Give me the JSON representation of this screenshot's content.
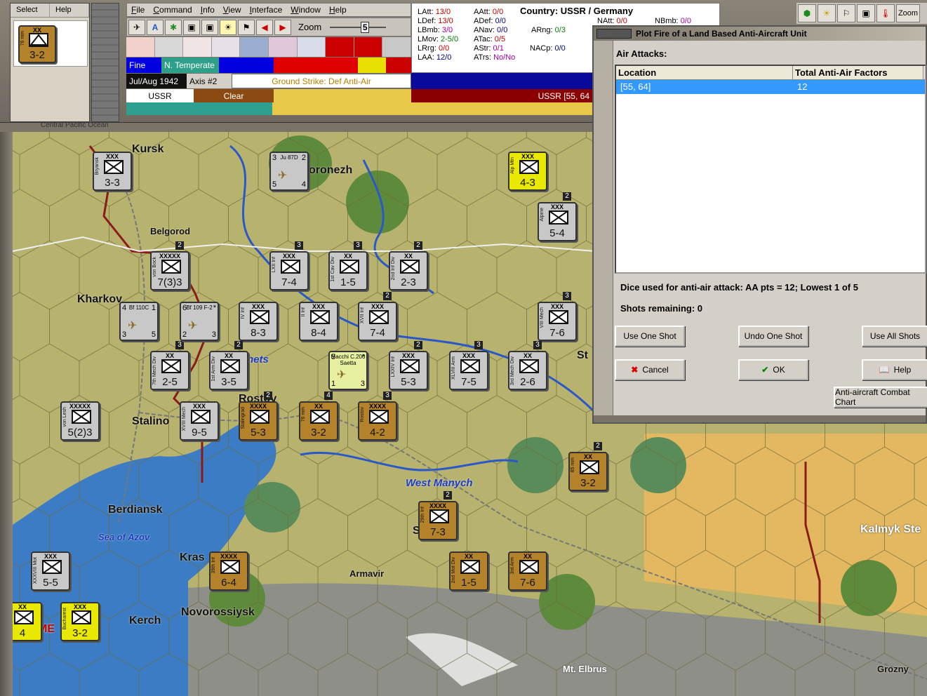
{
  "mini_panel": {
    "menu": [
      "Select",
      "Help"
    ],
    "unit_size": "XX",
    "unit_label": "76 mm",
    "unit_value": "3-2"
  },
  "menu": [
    "File",
    "Command",
    "Info",
    "View",
    "Interface",
    "Window",
    "Help"
  ],
  "toolbar": {
    "zoom_label": "Zoom",
    "zoom_value": "5"
  },
  "weather": {
    "ground": "Fine",
    "climate": "N. Temperate"
  },
  "turn": {
    "date": "Jul/Aug 1942",
    "phase": "Axis #2",
    "mission": "Ground Strike: Def Anti-Air"
  },
  "nation_row": {
    "nation": "USSR",
    "terrain": "Clear",
    "hex": "USSR [55, 64"
  },
  "stats": {
    "country": "Country: USSR / Germany",
    "LAtt": "13/0",
    "LDef": "13/0",
    "LBmb": "3/0",
    "LMov": "2-5/0",
    "LRrg": "0/0",
    "LAA": "12/0",
    "AAtt": "0/0",
    "ADef": "0/0",
    "ANav": "0/0",
    "ATac": "0/5",
    "AStr": "0/1",
    "ATrs": "No/No",
    "ARng": "0/3",
    "NACp": "0/0",
    "NAtt": "0/0",
    "NBmb": "0/0"
  },
  "right_toolbar": {
    "zoom": "Zoom"
  },
  "dialog": {
    "title": "Plot Fire of a Land Based Anti-Aircraft Unit",
    "air_attacks_label": "Air Attacks:",
    "columns": [
      "Location",
      "Total Anti-Air Factors"
    ],
    "rows": [
      {
        "location": "[55, 64]",
        "factors": "12"
      }
    ],
    "dice_text": "Dice used for anti-air attack:  AA pts = 12; Lowest 1 of 5",
    "shots_text": "Shots remaining:  0",
    "buttons": {
      "use_one": "Use One Shot",
      "undo_one": "Undo One Shot",
      "use_all": "Use All Shots",
      "cancel": "Cancel",
      "ok": "OK",
      "help": "Help",
      "chart": "Anti-aircraft Combat Chart"
    }
  },
  "map_labels": {
    "kursk": "Kursk",
    "voronezh": "oronezh",
    "belgorod": "Belgorod",
    "kharkov": "Kharkov",
    "donets": "nets",
    "stalino": "Stalino",
    "rostov": "Rostov",
    "berdiansk": "Berdiansk",
    "sea_of_azov": "Sea of Azov",
    "west_manych": "West Manych",
    "krasnodar": "Kras",
    "armavir": "Armavir",
    "kerch": "Kerch",
    "novorossiysk": "Novorossiysk",
    "mt_elbrus": "Mt. Elbrus",
    "grozny": "Grozny",
    "kalmyk": "Kalmyk Ste",
    "stalingrad_partial": "St",
    "voroshilovsk": "S        pol",
    "central_pacific": "Central Pacific Ocean",
    "me": "ME"
  },
  "units": [
    {
      "id": "kursk",
      "size": "XXX",
      "val": "3-3",
      "name": "Bryansk"
    },
    {
      "id": "vonbock",
      "size": "XXXXX",
      "val": "7(3)3",
      "name": "von Bock",
      "stack": "2"
    },
    {
      "id": "lxii",
      "size": "XXX",
      "val": "7-4",
      "name": "LXII Inf",
      "stack": "3"
    },
    {
      "id": "cav1",
      "size": "XX",
      "val": "1-5",
      "name": "1st Cav Div",
      "stack": "3"
    },
    {
      "id": "inf2",
      "size": "XX",
      "val": "2-3",
      "name": "2nd Inf Div",
      "stack": "2"
    },
    {
      "id": "alp1",
      "size": "XXX",
      "val": "4-3",
      "name": "Alp Mtn",
      "color": "yellow"
    },
    {
      "id": "alpine",
      "size": "XXX",
      "val": "5-4",
      "name": "Alpine",
      "stack": "2"
    },
    {
      "id": "iv",
      "size": "XXX",
      "val": "8-3",
      "name": "IV Inf"
    },
    {
      "id": "ivb",
      "size": "XXX",
      "val": "8-4",
      "name": "II Inf"
    },
    {
      "id": "xvii",
      "size": "XXX",
      "val": "7-4",
      "name": "XVII Inf",
      "stack": "2"
    },
    {
      "id": "viii",
      "size": "XXX",
      "val": "7-6",
      "name": "VIII Mech",
      "stack": "3"
    },
    {
      "id": "mech7",
      "size": "XX",
      "val": "2-5",
      "name": "7th Mech Div",
      "stack": "3"
    },
    {
      "id": "arm1",
      "size": "XX",
      "val": "3-5",
      "name": "1st Arm Div",
      "stack": "2"
    },
    {
      "id": "lxxiv",
      "size": "XXX",
      "val": "5-3",
      "name": "LXXIV Inf",
      "stack": "2"
    },
    {
      "id": "xlviii",
      "size": "XXX",
      "val": "7-5",
      "name": "XLVIII Arm",
      "stack": "3"
    },
    {
      "id": "mech3",
      "size": "XX",
      "val": "2-6",
      "name": "3rd Mech Div",
      "stack": "3"
    },
    {
      "id": "lesh",
      "size": "XXXXX",
      "val": "5(2)3",
      "name": "von Lesh"
    },
    {
      "id": "xviii",
      "size": "XXX",
      "val": "9-5",
      "name": "XVIII Mech"
    },
    {
      "id": "stalingrad",
      "size": "XXXX",
      "val": "5-3",
      "name": "Stalingrad",
      "color": "brown",
      "stack": "2"
    },
    {
      "id": "mm76",
      "size": "XX",
      "val": "3-2",
      "name": "76 mm",
      "color": "brown",
      "stack": "4"
    },
    {
      "id": "rostov",
      "size": "XXXX",
      "val": "4-2",
      "name": "Rostov",
      "color": "brown",
      "stack": "3"
    },
    {
      "id": "mm85",
      "size": "XX",
      "val": "3-2",
      "name": "85 mm",
      "color": "brown",
      "stack": "2"
    },
    {
      "id": "inf29",
      "size": "XXXX",
      "val": "7-3",
      "name": "29th Inf",
      "color": "brown",
      "stack": "2"
    },
    {
      "id": "xxxviii",
      "size": "XXX",
      "val": "5-5",
      "name": "XXXVIII Mot"
    },
    {
      "id": "inf39",
      "size": "XXXX",
      "val": "6-4",
      "name": "39th Inf",
      "color": "brown"
    },
    {
      "id": "mot2",
      "size": "XX",
      "val": "1-5",
      "name": "2nd Mot Div",
      "color": "brown"
    },
    {
      "id": "arm3",
      "size": "XX",
      "val": "7-6",
      "name": "3rd Arm",
      "color": "brown"
    },
    {
      "id": "bucharest",
      "size": "XXX",
      "val": "3-2",
      "name": "Bucharest",
      "color": "yellow"
    },
    {
      "id": "edge4",
      "size": "XX",
      "val": "4",
      "name": "",
      "color": "yellow"
    }
  ],
  "aircraft": [
    {
      "id": "ju87",
      "name": "Ju 87D",
      "tl": "3",
      "tr": "2",
      "bl": "5",
      "br": "4"
    },
    {
      "id": "bf110",
      "name": "Bf 110C",
      "tl": "4",
      "tr": "1",
      "bl": "3",
      "br": "5"
    },
    {
      "id": "bf109",
      "name": "Bf 109 F-2",
      "tl": "6",
      "tr": "*",
      "bl": "2",
      "br": "3"
    },
    {
      "id": "macchi",
      "name": "Macchi C.200 Saetta",
      "tl": "5",
      "tr": "*",
      "bl": "1",
      "br": "3"
    }
  ],
  "colors": {
    "map_terrain": "#b7b26e",
    "sea": "#3b7cc4",
    "selection": "#3399ff",
    "front_line": "#8b1a1a"
  }
}
